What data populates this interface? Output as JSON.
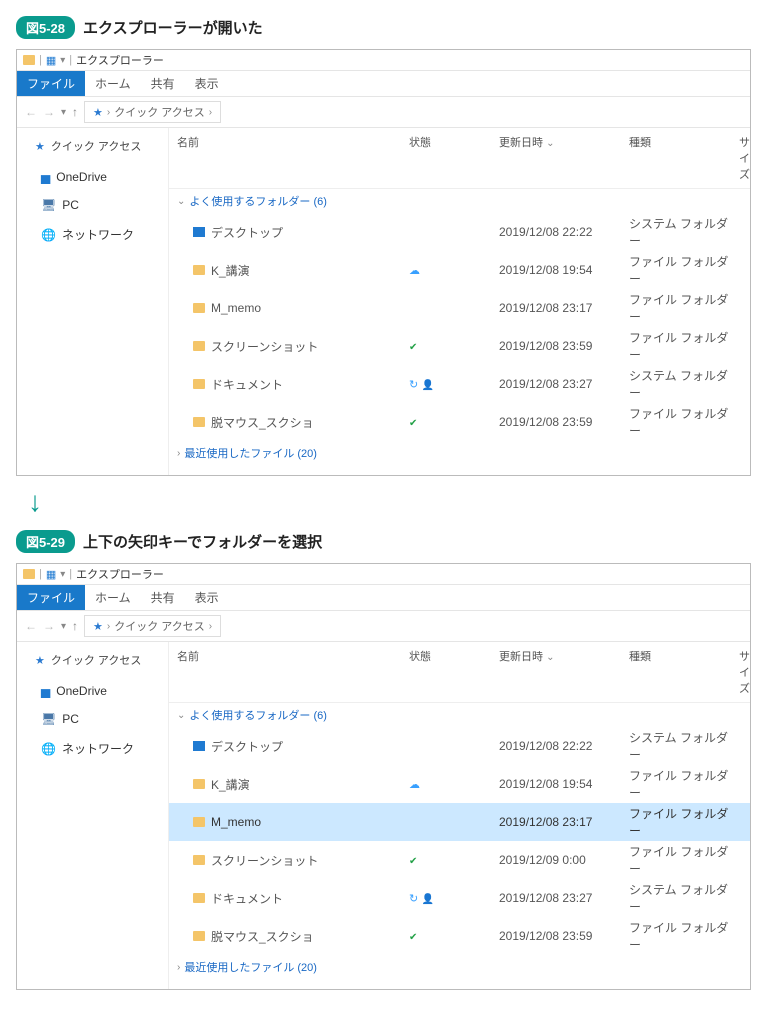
{
  "caption1": {
    "badge": "図5-28",
    "text": "エクスプローラーが開いた"
  },
  "caption2": {
    "badge": "図5-29",
    "text": "上下の矢印キーでフォルダーを選択"
  },
  "window": {
    "title": "エクスプローラー",
    "tabs": {
      "file": "ファイル",
      "home": "ホーム",
      "share": "共有",
      "view": "表示"
    },
    "breadcrumb": "クイック アクセス",
    "sidebar": {
      "quick_access": "クイック アクセス",
      "onedrive": "OneDrive",
      "pc": "PC",
      "network": "ネットワーク"
    },
    "columns": {
      "name": "名前",
      "status": "状態",
      "date": "更新日時",
      "type": "種類",
      "size": "サイズ"
    },
    "group_frequent": "よく使用するフォルダー (6)",
    "group_recent": "最近使用したファイル (20)"
  },
  "files1": [
    {
      "name": "デスクトップ",
      "status": "",
      "date": "2019/12/08 22:22",
      "type": "システム フォルダー",
      "icon": "desktop"
    },
    {
      "name": "K_講演",
      "status": "cloud",
      "date": "2019/12/08 19:54",
      "type": "ファイル フォルダー",
      "icon": "folder"
    },
    {
      "name": "M_memo",
      "status": "",
      "date": "2019/12/08 23:17",
      "type": "ファイル フォルダー",
      "icon": "folder"
    },
    {
      "name": "スクリーンショット",
      "status": "check",
      "date": "2019/12/08 23:59",
      "type": "ファイル フォルダー",
      "icon": "folder"
    },
    {
      "name": "ドキュメント",
      "status": "sync person",
      "date": "2019/12/08 23:27",
      "type": "システム フォルダー",
      "icon": "folder"
    },
    {
      "name": "脱マウス_スクショ",
      "status": "check",
      "date": "2019/12/08 23:59",
      "type": "ファイル フォルダー",
      "icon": "folder"
    }
  ],
  "files2": [
    {
      "name": "デスクトップ",
      "status": "",
      "date": "2019/12/08 22:22",
      "type": "システム フォルダー",
      "icon": "desktop",
      "selected": false
    },
    {
      "name": "K_講演",
      "status": "cloud",
      "date": "2019/12/08 19:54",
      "type": "ファイル フォルダー",
      "icon": "folder",
      "selected": false
    },
    {
      "name": "M_memo",
      "status": "",
      "date": "2019/12/08 23:17",
      "type": "ファイル フォルダー",
      "icon": "folder",
      "selected": true
    },
    {
      "name": "スクリーンショット",
      "status": "check",
      "date": "2019/12/09 0:00",
      "type": "ファイル フォルダー",
      "icon": "folder",
      "selected": false
    },
    {
      "name": "ドキュメント",
      "status": "sync person",
      "date": "2019/12/08 23:27",
      "type": "システム フォルダー",
      "icon": "folder",
      "selected": false
    },
    {
      "name": "脱マウス_スクショ",
      "status": "check",
      "date": "2019/12/08 23:59",
      "type": "ファイル フォルダー",
      "icon": "folder",
      "selected": false
    }
  ]
}
